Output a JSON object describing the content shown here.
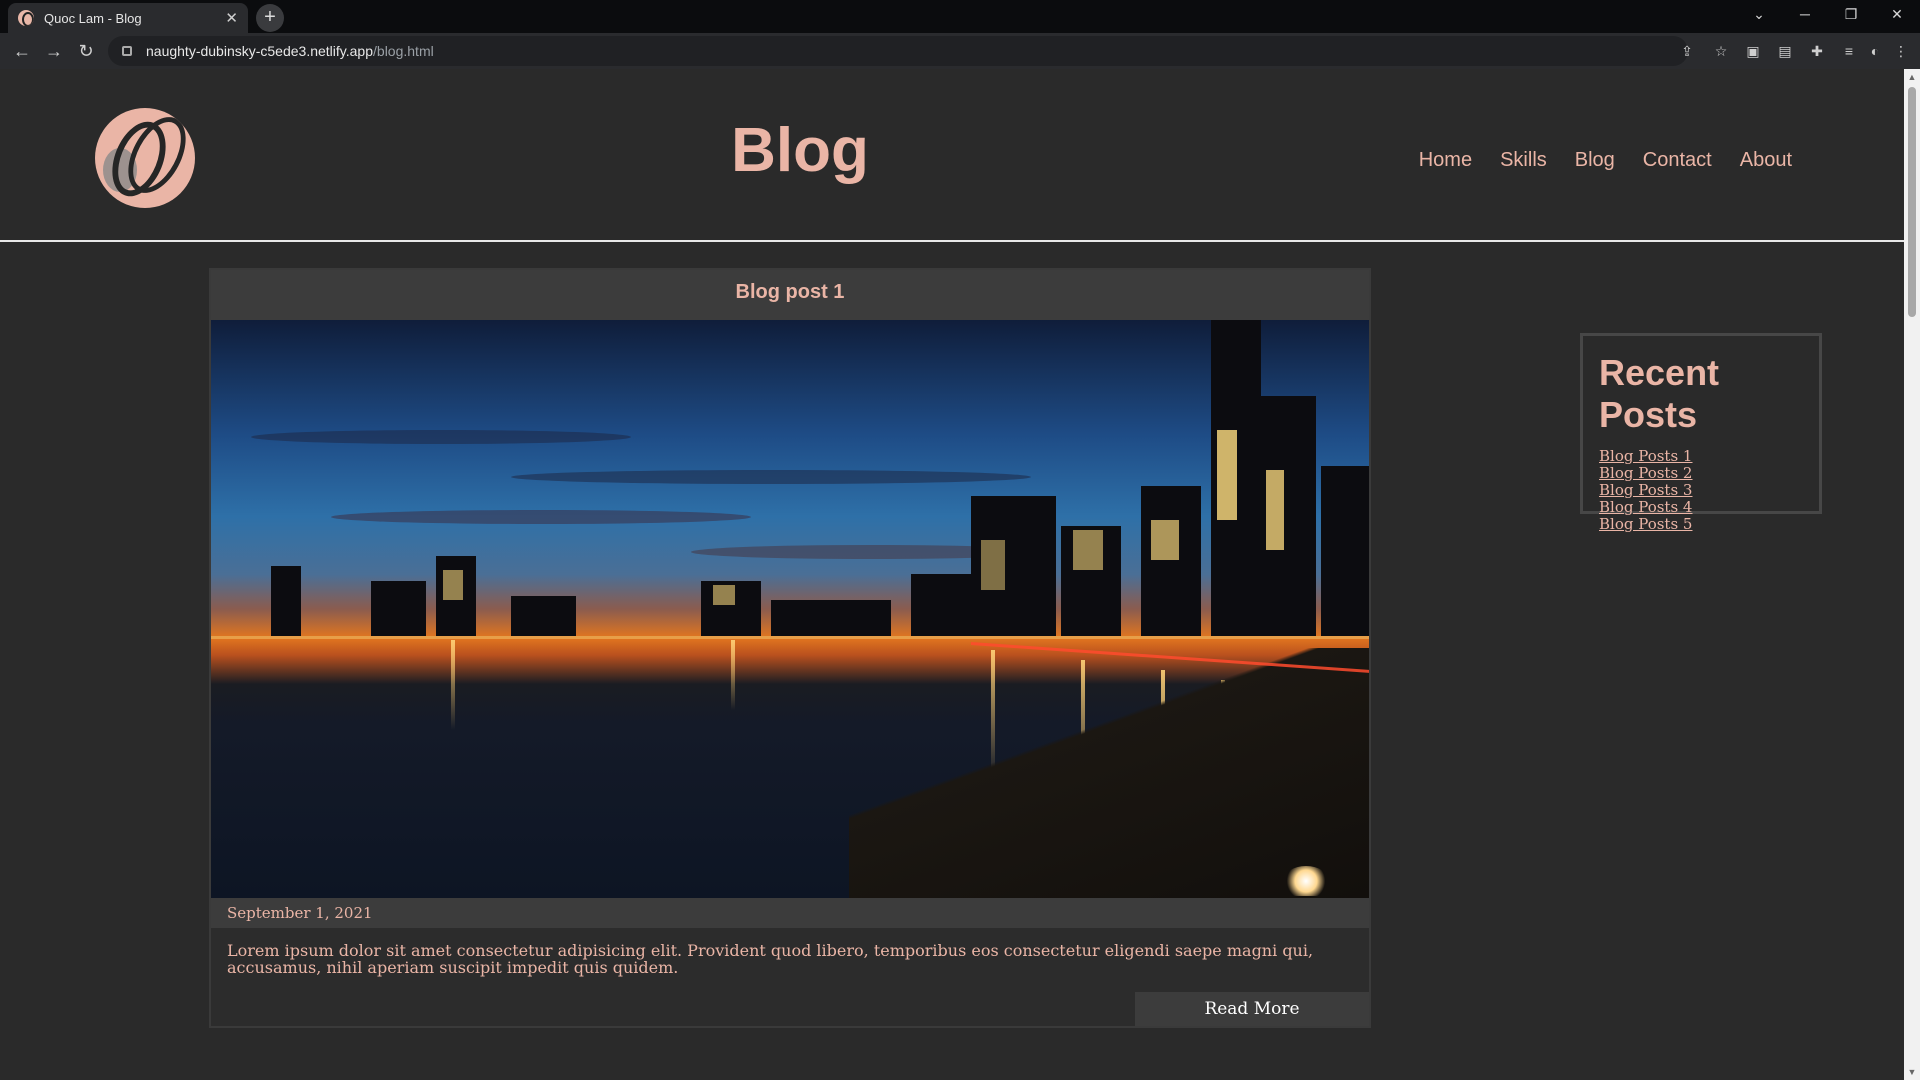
{
  "browser": {
    "tab_title": "Quoc Lam - Blog",
    "url_host": "naughty-dubinsky-c5ede3.netlify.app",
    "url_path": "/blog.html"
  },
  "site": {
    "title": "Blog",
    "nav": [
      "Home",
      "Skills",
      "Blog",
      "Contact",
      "About"
    ]
  },
  "post": {
    "title": "Blog post 1",
    "date": "September 1, 2021",
    "body": "Lorem ipsum dolor sit amet consectetur adipisicing elit. Provident quod libero, temporibus eos consectetur eligendi saepe magni qui, accusamus, nihil aperiam suscipit impedit quis quidem.",
    "read_more": "Read More"
  },
  "sidebar": {
    "heading": "Recent Posts",
    "links": [
      "Blog Posts 1",
      "Blog Posts 2",
      "Blog Posts 3",
      "Blog Posts 4",
      "Blog Posts 5"
    ]
  },
  "colors": {
    "accent": "#eab5a6",
    "page_bg": "#2a2a2a",
    "panel_bg": "#3c3c3c"
  }
}
